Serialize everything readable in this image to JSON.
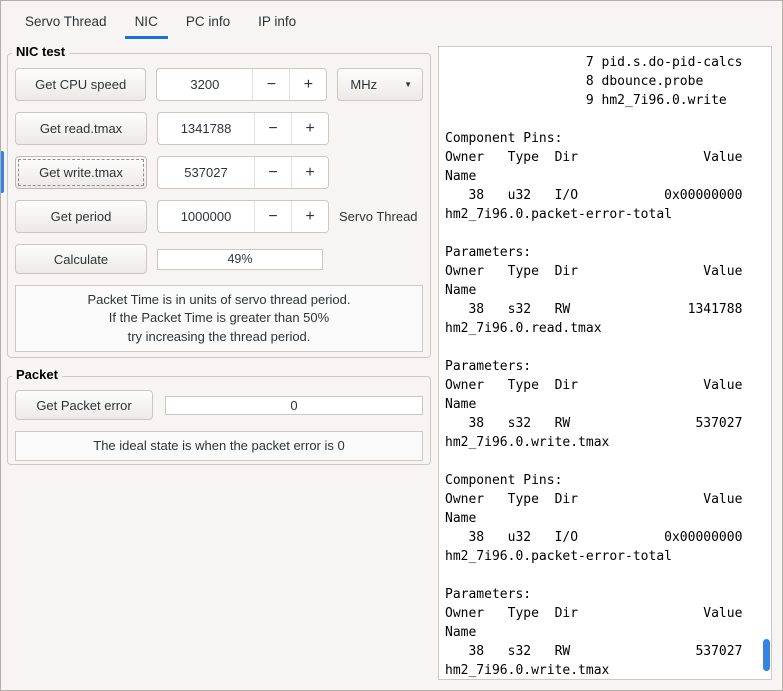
{
  "accent_color": "#1c71d8",
  "icons": {
    "minus": "−",
    "plus": "+",
    "dropdown_arrow": "▼"
  },
  "tabs": [
    {
      "label": "Servo Thread"
    },
    {
      "label": "NIC"
    },
    {
      "label": "PC info"
    },
    {
      "label": "IP info"
    }
  ],
  "nic_test": {
    "legend": "NIC test",
    "rows": [
      {
        "button": "Get CPU speed",
        "value": "3200",
        "unit": "MHz"
      },
      {
        "button": "Get read.tmax",
        "value": "1341788"
      },
      {
        "button": "Get write.tmax",
        "value": "537027"
      },
      {
        "button": "Get period",
        "value": "1000000",
        "suffix": "Servo Thread"
      }
    ],
    "calculate_button": "Calculate",
    "progress_text": "49%",
    "note_lines": [
      "Packet Time is in units of servo thread period.",
      "If the Packet Time is greater than 50%",
      "try increasing the thread period."
    ]
  },
  "packet": {
    "legend": "Packet",
    "button": "Get Packet error",
    "value": "0",
    "note": "The ideal state is when the packet error is 0"
  },
  "output": {
    "lines": [
      "                  7 pid.s.do-pid-calcs",
      "                  8 dbounce.probe",
      "                  9 hm2_7i96.0.write",
      "",
      "Component Pins:",
      "Owner   Type  Dir                Value",
      "Name",
      "   38   u32   I/O           0x00000000",
      "hm2_7i96.0.packet-error-total",
      "",
      "Parameters:",
      "Owner   Type  Dir                Value",
      "Name",
      "   38   s32   RW               1341788",
      "hm2_7i96.0.read.tmax",
      "",
      "Parameters:",
      "Owner   Type  Dir                Value",
      "Name",
      "   38   s32   RW                537027",
      "hm2_7i96.0.write.tmax",
      "",
      "Component Pins:",
      "Owner   Type  Dir                Value",
      "Name",
      "   38   u32   I/O           0x00000000",
      "hm2_7i96.0.packet-error-total",
      "",
      "Parameters:",
      "Owner   Type  Dir                Value",
      "Name",
      "   38   s32   RW                537027",
      "hm2_7i96.0.write.tmax"
    ]
  }
}
